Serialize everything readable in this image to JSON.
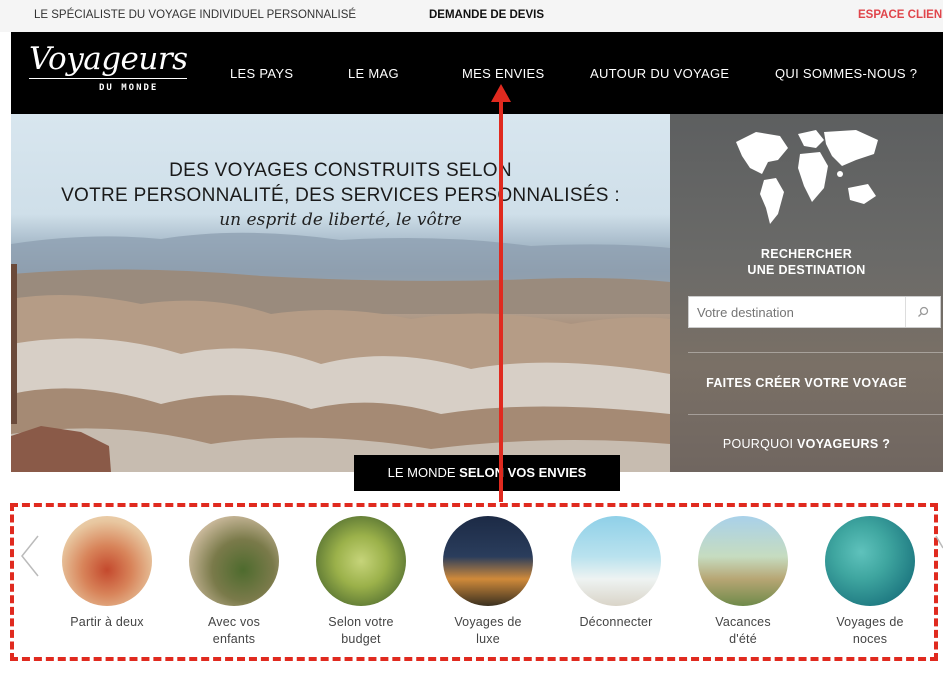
{
  "topbar": {
    "tagline": "LE SPÉCIALISTE DU VOYAGE INDIVIDUEL PERSONNALISÉ",
    "quote_link": "DEMANDE DE DEVIS",
    "client_link": "ESPACE CLIEN"
  },
  "brand": {
    "name": "Voyageurs",
    "subtitle": "DU MONDE"
  },
  "nav": {
    "items": [
      {
        "label": "LES PAYS"
      },
      {
        "label": "LE MAG"
      },
      {
        "label": "MES ENVIES"
      },
      {
        "label": "AUTOUR DU VOYAGE"
      },
      {
        "label": "QUI SOMMES-NOUS ?"
      }
    ]
  },
  "hero": {
    "title_line1": "DES VOYAGES CONSTRUITS SELON",
    "title_line2": "VOTRE PERSONNALITÉ, DES SERVICES PERSONNALISÉS :",
    "subtitle": "un esprit de liberté, le vôtre",
    "button_prefix": "LE MONDE ",
    "button_bold": "SELON VOS ENVIES"
  },
  "panel": {
    "search_title_line1": "RECHERCHER",
    "search_title_line2": "UNE DESTINATION",
    "search_placeholder": "Votre destination",
    "cta_create": "FAITES CRÉER VOTRE VOYAGE",
    "cta_why_prefix": "POURQUOI ",
    "cta_why_bold": "VOYAGEURS ?"
  },
  "categories": [
    {
      "line1": "Partir à deux",
      "line2": "",
      "icon": "couple-bedroom-image",
      "colors": [
        "#e8c7a0",
        "#c4492d"
      ]
    },
    {
      "line1": "Avec vos",
      "line2": "enfants",
      "icon": "taj-mahal-child-image",
      "colors": [
        "#c9b89a",
        "#4e6b2e"
      ]
    },
    {
      "line1": "Selon votre",
      "line2": "budget",
      "icon": "market-vegetables-image",
      "colors": [
        "#9bb14a",
        "#3e5a28"
      ]
    },
    {
      "line1": "Voyages de",
      "line2": "luxe",
      "icon": "luxury-villa-image",
      "colors": [
        "#2a3d5c",
        "#d08a3a"
      ]
    },
    {
      "line1": "Déconnecter",
      "line2": "",
      "icon": "beach-palm-image",
      "colors": [
        "#8fd0e8",
        "#eef3f2"
      ]
    },
    {
      "line1": "Vacances",
      "line2": "d'été",
      "icon": "family-walk-image",
      "colors": [
        "#a9d1ea",
        "#b7a674"
      ]
    },
    {
      "line1": "Voyages de",
      "line2": "noces",
      "icon": "overwater-deck-image",
      "colors": [
        "#1f7a82",
        "#3fa6a0"
      ]
    }
  ],
  "colors": {
    "accent_red": "#e02a1f",
    "client_link": "#e0454b",
    "nav_bg": "#000000"
  }
}
